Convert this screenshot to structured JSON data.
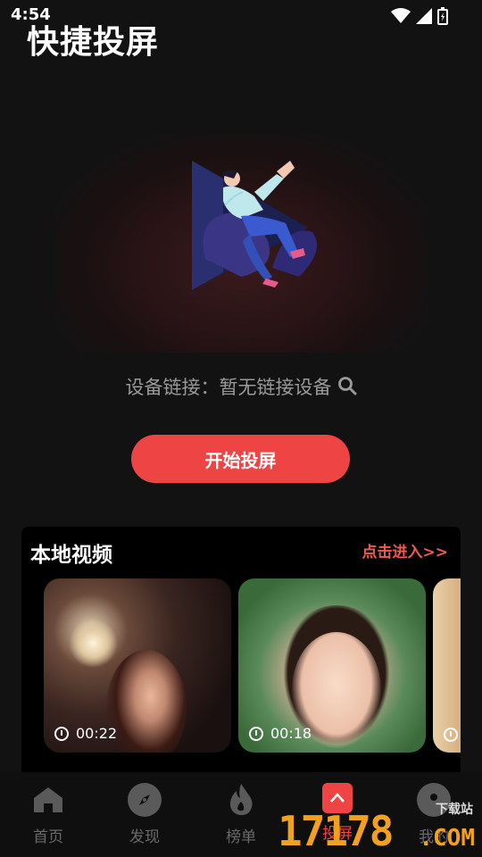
{
  "status": {
    "time": "4:54"
  },
  "app": {
    "title": "快捷投屏"
  },
  "device": {
    "label": "设备链接：暂无链接设备"
  },
  "cast": {
    "start_label": "开始投屏"
  },
  "local": {
    "title": "本地视频",
    "link": "点击进入>>",
    "videos": [
      {
        "duration": "00:22"
      },
      {
        "duration": "00:18"
      }
    ]
  },
  "nav": {
    "items": [
      {
        "label": "首页",
        "icon": "home-icon"
      },
      {
        "label": "发现",
        "icon": "compass-icon"
      },
      {
        "label": "榜单",
        "icon": "flame-icon"
      },
      {
        "label": "投屏",
        "icon": "cast-icon",
        "active": true
      },
      {
        "label": "我的",
        "icon": "profile-icon"
      }
    ]
  },
  "watermark": {
    "number": "17178",
    "domain": ".COM",
    "tag": "下载站"
  },
  "colors": {
    "accent": "#ef4444",
    "link": "#f05a4e",
    "background": "#121212"
  }
}
